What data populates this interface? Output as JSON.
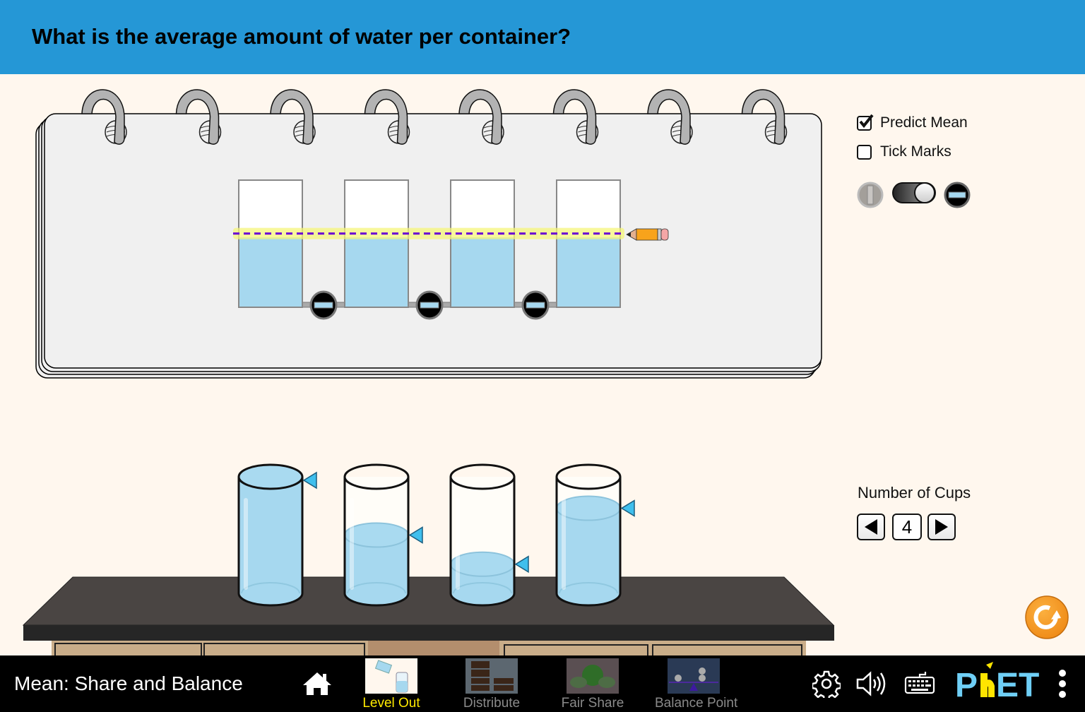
{
  "header": {
    "question": "What is the average amount of water per container?",
    "background_color": "#2597d6"
  },
  "controls": {
    "predict_mean": {
      "label": "Predict Mean",
      "checked": true
    },
    "tick_marks": {
      "label": "Tick Marks",
      "checked": false
    },
    "pipe_toggle": {
      "state": "closed",
      "left_icon": "pipe-open-icon",
      "right_icon": "pipe-closed-icon"
    },
    "number_of_cups": {
      "label": "Number of Cups",
      "value": "4",
      "decrement_icon": "left-triangle-icon",
      "increment_icon": "right-triangle-icon"
    }
  },
  "notebook": {
    "rings": 8,
    "representation_cups": [
      {
        "fill_fraction": 0.55
      },
      {
        "fill_fraction": 0.55
      },
      {
        "fill_fraction": 0.55
      },
      {
        "fill_fraction": 0.55
      }
    ],
    "pipes": [
      {
        "valve": "closed"
      },
      {
        "valve": "closed"
      },
      {
        "valve": "closed"
      }
    ],
    "predict_mean_line": {
      "level_fraction": 0.58,
      "color": "#6a00d4",
      "highlight_color": "#f5f57a"
    },
    "water_color": "#a6d8ef"
  },
  "table_cups": [
    {
      "fill_fraction": 1.0
    },
    {
      "fill_fraction": 0.5
    },
    {
      "fill_fraction": 0.25
    },
    {
      "fill_fraction": 0.73
    }
  ],
  "reset_button": {
    "icon": "reset-icon",
    "color": "#f7941d"
  },
  "navbar": {
    "sim_title": "Mean: Share and Balance",
    "home_icon": "home-icon",
    "screens": [
      {
        "label": "Level Out",
        "active": true
      },
      {
        "label": "Distribute",
        "active": false
      },
      {
        "label": "Fair Share",
        "active": false
      },
      {
        "label": "Balance Point",
        "active": false
      }
    ],
    "settings_icon": "gear-icon",
    "sound_icon": "speaker-icon",
    "keyboard_icon": "keyboard-icon",
    "logo": "PhET",
    "menu_icon": "kebab-menu-icon"
  }
}
